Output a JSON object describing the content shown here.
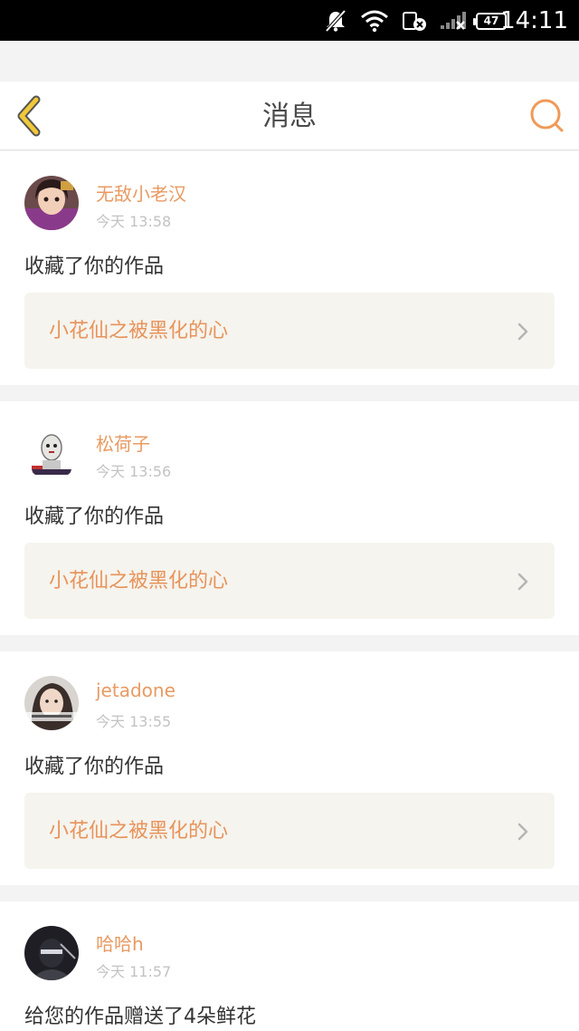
{
  "status_bar": {
    "time": "14:11",
    "battery": "47",
    "icons": [
      "bell-muted-icon",
      "wifi-icon",
      "sim-error-icon",
      "signal-icon",
      "battery-icon"
    ]
  },
  "header": {
    "title": "消息",
    "back_icon": "back-arrow-icon",
    "search_icon": "search-icon"
  },
  "colors": {
    "accent": "#e8935a",
    "back_arrow": "#e8c23a",
    "card_link_bg": "#f5f4ee"
  },
  "messages": [
    {
      "username": "无敌小老汉",
      "time": "今天 13:58",
      "action": "收藏了你的作品",
      "work_title": "小花仙之被黑化的心"
    },
    {
      "username": "松荷子",
      "time": "今天 13:56",
      "action": "收藏了你的作品",
      "work_title": "小花仙之被黑化的心"
    },
    {
      "username": "jetadone",
      "time": "今天 13:55",
      "action": "收藏了你的作品",
      "work_title": "小花仙之被黑化的心"
    },
    {
      "username": "哈哈h",
      "time": "今天 11:57",
      "action": "给您的作品赠送了4朵鲜花"
    }
  ]
}
